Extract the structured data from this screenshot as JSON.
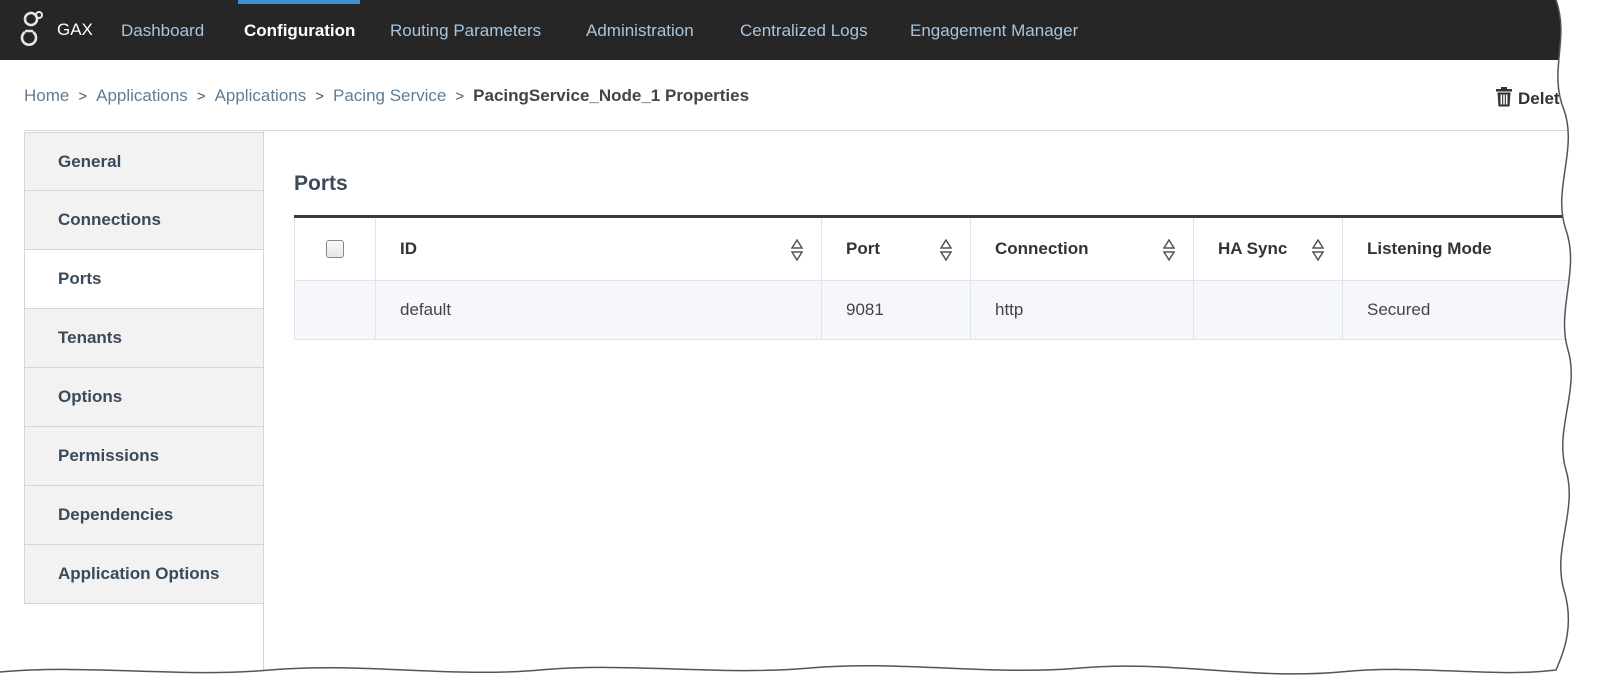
{
  "brand": "GAX",
  "nav": {
    "items": [
      {
        "label": "Dashboard"
      },
      {
        "label": "Configuration",
        "active": true
      },
      {
        "label": "Routing Parameters"
      },
      {
        "label": "Administration"
      },
      {
        "label": "Centralized Logs"
      },
      {
        "label": "Engagement Manager"
      }
    ]
  },
  "breadcrumb": {
    "items": [
      "Home",
      "Applications",
      "Applications",
      "Pacing Service"
    ],
    "separator": ">",
    "current": "PacingService_Node_1 Properties"
  },
  "toolbar": {
    "delete_label": "Delet"
  },
  "tabs": [
    {
      "label": "General"
    },
    {
      "label": "Connections"
    },
    {
      "label": "Ports",
      "active": true
    },
    {
      "label": "Tenants"
    },
    {
      "label": "Options"
    },
    {
      "label": "Permissions"
    },
    {
      "label": "Dependencies"
    },
    {
      "label": "Application Options"
    }
  ],
  "ports": {
    "title": "Ports",
    "columns": [
      "ID",
      "Port",
      "Connection",
      "HA Sync",
      "Listening Mode"
    ],
    "rows": [
      {
        "id": "default",
        "port": "9081",
        "connection": "http",
        "ha_sync": "",
        "listening_mode": "Secured"
      }
    ]
  },
  "colors": {
    "nav_bg": "#262626",
    "nav_link": "#a9c4dd",
    "active_indicator": "#3e8ed0"
  }
}
